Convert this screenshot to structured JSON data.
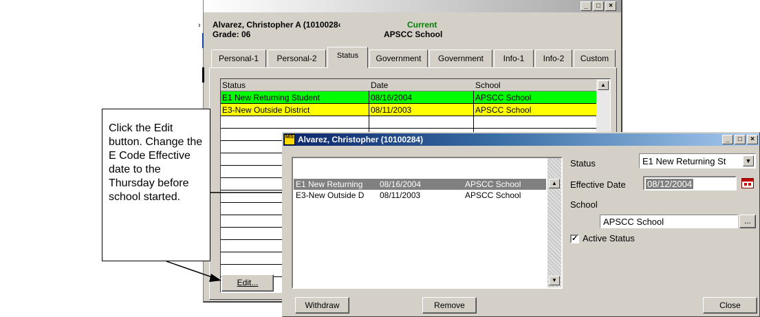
{
  "main_window": {
    "student_name": "Alvarez, Christopher A (1010028‹",
    "grade": "Grade: 06",
    "enrollment": "Current",
    "school": "APSCC School",
    "tabs": [
      "Personal-1",
      "Personal-2",
      "Status",
      "Government",
      "Government",
      "Info-1",
      "Info-2",
      "Custom"
    ],
    "active_tab": "Status",
    "table": {
      "headers": [
        "Status",
        "Date",
        "School"
      ],
      "rows": [
        {
          "status": "E1 New Returning Student",
          "date": "08/16/2004",
          "school": "APSCC School",
          "color": "#00ff00"
        },
        {
          "status": "E3-New Outside District",
          "date": "08/11/2003",
          "school": "APSCC School",
          "color": "#ffff00"
        }
      ]
    },
    "edit_label": "Edit..."
  },
  "callout": {
    "text": "Click the Edit button. Change the E Code Effective date to the Thursday before school started."
  },
  "dialog": {
    "title": "Alvarez, Christopher (10100284)",
    "list": [
      {
        "name": "E1 New Returning",
        "date": "08/16/2004",
        "school": "APSCC School"
      },
      {
        "name": "E3-New Outside D",
        "date": "08/11/2003",
        "school": "APSCC School"
      }
    ],
    "status_label": "Status",
    "status_value": "E1 New Returning St",
    "effective_date_label": "Effective Date",
    "effective_date_value": "08/12/2004",
    "school_label": "School",
    "school_value": "APSCC School",
    "browse_label": "...",
    "active_status_label": "Active Status",
    "withdraw_label": "Withdraw",
    "remove_label": "Remove",
    "close_label": "Close"
  },
  "colors": {
    "titlebar_start": "#0a246a",
    "titlebar_end": "#a6caf0",
    "green_row": "#00ff00",
    "yellow_row": "#ffff00",
    "selected_row": "#808080"
  }
}
